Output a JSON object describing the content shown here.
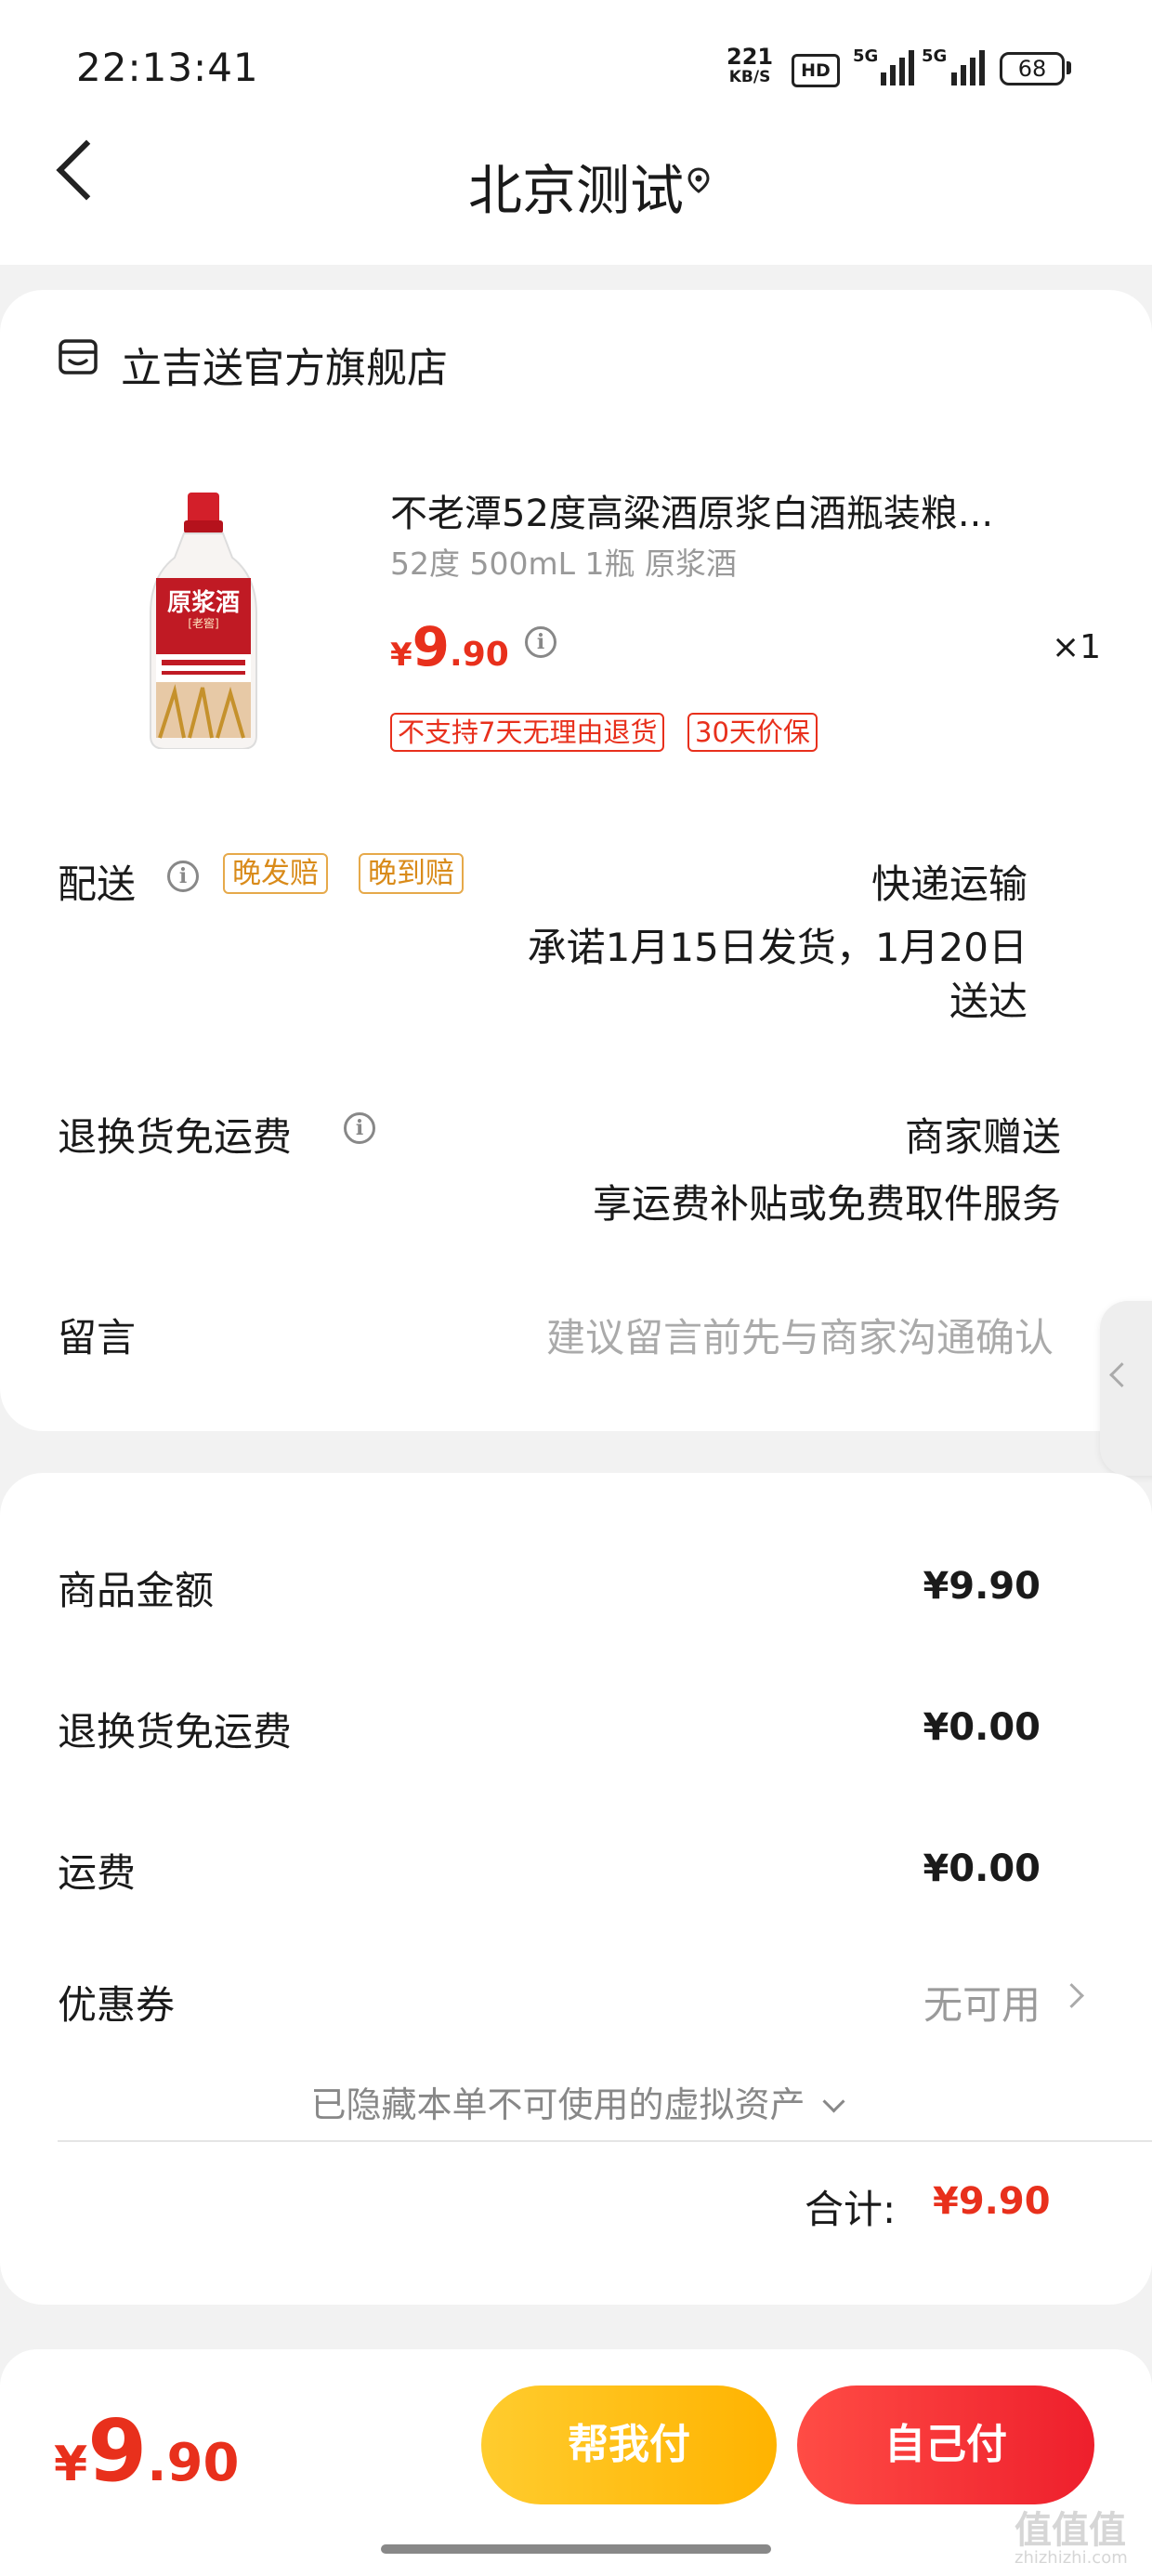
{
  "status_bar": {
    "time": "22:13:41",
    "net_speed": "221",
    "net_unit": "KB/S",
    "hd": "HD",
    "signal1": "5G",
    "signal2": "5G",
    "battery": "68"
  },
  "header": {
    "title": "北京测试",
    "back_icon": "back-arrow-icon",
    "location_icon": "location-pin-icon"
  },
  "shop": {
    "name": "立吉送官方旗舰店",
    "icon": "store-icon"
  },
  "product": {
    "title": "不老潭52度高粱酒原浆白酒瓶装粮...",
    "spec": "52度 500mL 1瓶 原浆酒",
    "price_symbol": "¥",
    "price_int": "9",
    "price_dec": ".90",
    "quantity": "×1",
    "tags": [
      "不支持7天无理由退货",
      "30天价保"
    ],
    "image_label": "原浆酒",
    "image_sub": "[老窖]"
  },
  "delivery": {
    "label": "配送",
    "badges": [
      "晚发赔",
      "晚到赔"
    ],
    "method": "快递运输",
    "promise_line1": "承诺1月15日发货，1月20日",
    "promise_line2": "送达"
  },
  "return_shipping": {
    "label": "退换货免运费",
    "value_line1": "商家赠送",
    "value_line2": "享运费补贴或免费取件服务"
  },
  "message": {
    "label": "留言",
    "placeholder": "建议留言前先与商家沟通确认"
  },
  "summary": {
    "items": [
      {
        "label": "商品金额",
        "value": "¥9.90"
      },
      {
        "label": "退换货免运费",
        "value": "¥0.00"
      },
      {
        "label": "运费",
        "value": "¥0.00"
      }
    ],
    "coupon_label": "优惠券",
    "coupon_value": "无可用",
    "hidden_assets": "已隐藏本单不可使用的虚拟资产",
    "total_label": "合计:",
    "total_value": "¥9.90"
  },
  "bottom_bar": {
    "price_symbol": "¥",
    "price_int": "9",
    "price_dec": ".90",
    "help_pay": "帮我付",
    "self_pay": "自己付"
  },
  "watermark": {
    "mark": "值值值",
    "site": "zhizhizhi.com"
  },
  "colors": {
    "accent_red": "#e8301c",
    "button_yellow": "#ffb300",
    "button_red": "#ee1f2c"
  }
}
